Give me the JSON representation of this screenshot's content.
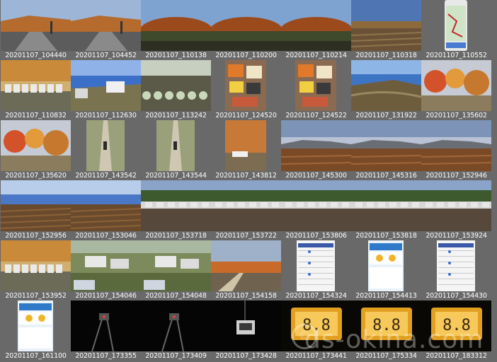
{
  "watermark": {
    "text": "ds-okina.com",
    "symbol": "©"
  },
  "photos": [
    {
      "caption": "20201107_104440",
      "scene": "road"
    },
    {
      "caption": "20201107_104452",
      "scene": "road2"
    },
    {
      "caption": "20201107_110138",
      "scene": "hill"
    },
    {
      "caption": "20201107_110200",
      "scene": "hill2"
    },
    {
      "caption": "20201107_110214",
      "scene": "hill3"
    },
    {
      "caption": "20201107_110318",
      "scene": "field"
    },
    {
      "caption": "20201107_110552",
      "scene": "phone-map"
    },
    {
      "caption": "20201107_110832",
      "scene": "hives"
    },
    {
      "caption": "20201107_112630",
      "scene": "van"
    },
    {
      "caption": "20201107_113242",
      "scene": "cabbage"
    },
    {
      "caption": "20201107_124520",
      "scene": "food"
    },
    {
      "caption": "20201107_124522",
      "scene": "food2"
    },
    {
      "caption": "20201107_131922",
      "scene": "valley"
    },
    {
      "caption": "20201107_135602",
      "scene": "trees"
    },
    {
      "caption": "20201107_135620",
      "scene": "autumn"
    },
    {
      "caption": "20201107_143542",
      "scene": "path"
    },
    {
      "caption": "20201107_143544",
      "scene": "path2"
    },
    {
      "caption": "20201107_143812",
      "scene": "car"
    },
    {
      "caption": "20201107_145300",
      "scene": "plain"
    },
    {
      "caption": "20201107_145316",
      "scene": "plain2"
    },
    {
      "caption": "20201107_152946",
      "scene": "plain3"
    },
    {
      "caption": "20201107_152956",
      "scene": "farm"
    },
    {
      "caption": "20201107_153046",
      "scene": "farm2"
    },
    {
      "caption": "20201107_153718",
      "scene": "lot"
    },
    {
      "caption": "20201107_153722",
      "scene": "lot2"
    },
    {
      "caption": "20201107_153806",
      "scene": "lot3"
    },
    {
      "caption": "20201107_153818",
      "scene": "lot4"
    },
    {
      "caption": "20201107_153924",
      "scene": "lot5"
    },
    {
      "caption": "20201107_153952",
      "scene": "hives2"
    },
    {
      "caption": "20201107_154046",
      "scene": "cars"
    },
    {
      "caption": "20201107_154048",
      "scene": "cars2"
    },
    {
      "caption": "20201107_154158",
      "scene": "lane"
    },
    {
      "caption": "20201107_154324",
      "scene": "weather"
    },
    {
      "caption": "20201107_154413",
      "scene": "weather2"
    },
    {
      "caption": "20201107_154430",
      "scene": "weather3"
    },
    {
      "caption": "20201107_161100",
      "scene": "weather4"
    },
    {
      "caption": "20201107_173355",
      "scene": "night"
    },
    {
      "caption": "20201107_173409",
      "scene": "night2"
    },
    {
      "caption": "20201107_173428",
      "scene": "night3"
    },
    {
      "caption": "20201107_173441",
      "scene": "display"
    },
    {
      "caption": "20201107_175334",
      "scene": "display2"
    },
    {
      "caption": "20201107_183312",
      "scene": "display3"
    }
  ]
}
